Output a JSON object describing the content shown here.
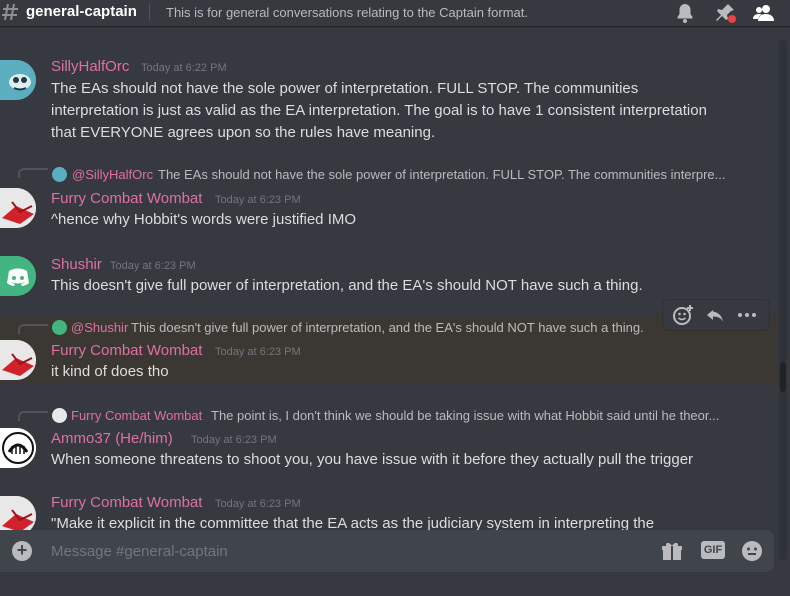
{
  "header": {
    "channel_name": "general-captain",
    "topic": "This is for general conversations relating to the Captain format.",
    "icons": [
      "hash-icon",
      "bell-icon",
      "pin-icon",
      "members-icon"
    ]
  },
  "messages": [
    {
      "author": "SillyHalfOrc",
      "timestamp": "Today at 6:22 PM",
      "lines": [
        "The EAs should not have the sole power of interpretation. FULL STOP. The communities",
        "interpretation is just as valid as the EA interpretation.  The goal is to have 1 consistent interpretation",
        "that EVERYONE agrees upon so the rules have meaning."
      ]
    },
    {
      "reply_author": "@SillyHalfOrc",
      "reply_text": "The EAs should not have the sole power of interpretation. FULL STOP. The communities interpre...",
      "author": "Furry Combat Wombat",
      "timestamp": "Today at 6:23 PM",
      "lines": [
        "^hence why Hobbit's words were justified IMO"
      ]
    },
    {
      "author": "Shushir",
      "timestamp": "Today at 6:23 PM",
      "lines": [
        "This doesn't give full power of interpretation, and the EA's should NOT have such a thing."
      ]
    },
    {
      "reply_author": "@Shushir",
      "reply_text": "This doesn't give full power of interpretation, and the EA's should NOT have such a thing.",
      "author": "Furry Combat Wombat",
      "timestamp": "Today at 6:23 PM",
      "lines": [
        "it kind of does tho"
      ]
    },
    {
      "reply_author": "Furry Combat Wombat",
      "reply_text": "The point is, I don't think we should be taking issue with what Hobbit said until he theor...",
      "author": "Ammo37 (He/him)",
      "timestamp": "Today at 6:23 PM",
      "lines": [
        "When someone threatens to shoot you, you have issue with it before they actually pull the trigger"
      ]
    },
    {
      "author": "Furry Combat Wombat",
      "timestamp": "Today at 6:23 PM",
      "lines": [
        "\"Make it explicit in the committee that the EA acts as the judiciary system in interpreting the"
      ]
    }
  ],
  "composer": {
    "placeholder": "Message #general-captain",
    "gif_label": "GIF",
    "add_label": "+"
  },
  "colors": {
    "background": "#36393f",
    "author_pink": "#e06fa3",
    "highlight": "#3b3833",
    "composer_bg": "#40444b",
    "discord_blurple": "#43b581"
  }
}
